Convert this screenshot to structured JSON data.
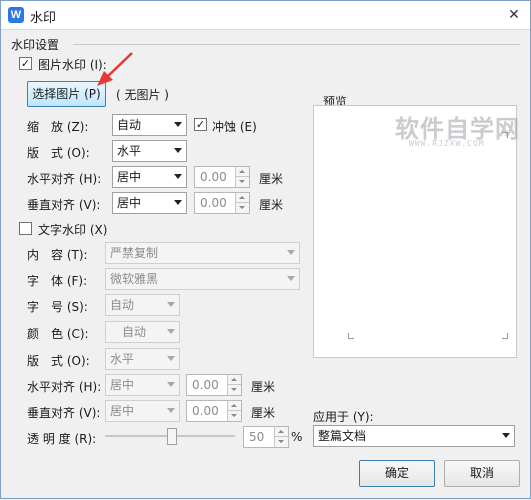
{
  "window": {
    "title": "水印",
    "app_icon_letter": "W",
    "close_glyph": "✕"
  },
  "section": {
    "label": "水印设置"
  },
  "picture": {
    "checkbox_label": "图片水印 (I):",
    "checked": true,
    "select_button": "选择图片 (P)",
    "no_picture": "( 无图片 )",
    "scale_label": "缩　放 (Z):",
    "scale_value": "自动",
    "washout_label": "冲蚀 (E)",
    "washout_checked": true,
    "layout_label": "版　式 (O):",
    "layout_value": "水平",
    "h_align_label": "水平对齐 (H):",
    "h_align_value": "居中",
    "h_offset": "0.00",
    "v_align_label": "垂直对齐 (V):",
    "v_align_value": "居中",
    "v_offset": "0.00",
    "unit": "厘米"
  },
  "text": {
    "checkbox_label": "文字水印 (X)",
    "checked": false,
    "content_label": "内　容 (T):",
    "content_value": "严禁复制",
    "font_label": "字　体 (F):",
    "font_value": "微软雅黑",
    "size_label": "字　号 (S):",
    "size_value": "自动",
    "color_label": "颜　色 (C):",
    "color_value": "自动",
    "layout_label": "版　式 (O):",
    "layout_value": "水平",
    "h_align_label": "水平对齐 (H):",
    "h_align_value": "居中",
    "h_offset": "0.00",
    "v_align_label": "垂直对齐 (V):",
    "v_align_value": "居中",
    "v_offset": "0.00",
    "unit": "厘米",
    "transparency_label": "透 明 度 (R):",
    "transparency_value": "50",
    "transparency_fraction": 0.5,
    "percent": "%"
  },
  "preview": {
    "label": "预览"
  },
  "apply": {
    "label": "应用于 (Y):",
    "value": "整篇文档"
  },
  "buttons": {
    "ok": "确定",
    "cancel": "取消"
  },
  "watermark": {
    "text": "软件自学网",
    "sub": "WWW.RJZXW.COM"
  },
  "colors": {
    "annotation_arrow": "#e53935",
    "accent": "#2b78e4"
  }
}
